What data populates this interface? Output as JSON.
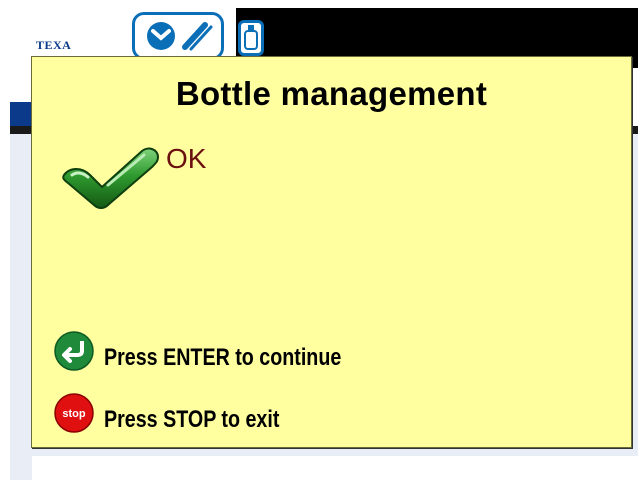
{
  "app": {
    "logo_text": "TEXA"
  },
  "header_icons": [
    {
      "name": "tools-icon"
    },
    {
      "name": "bottle-icon"
    }
  ],
  "dialog": {
    "title": "Bottle management",
    "status_icon": "checkmark-icon",
    "status_text": "OK",
    "hints": [
      {
        "icon": "enter-icon",
        "label": "Press ENTER to continue"
      },
      {
        "icon": "stop-icon",
        "label": "Press STOP to exit",
        "icon_text": "stop"
      }
    ]
  },
  "colors": {
    "dialog_background": "#ffffa0",
    "status_text": "#6b0f0f",
    "check_green": "#2e8b2e",
    "enter_green": "#1f8a3a",
    "stop_red": "#e01010",
    "brand_blue": "#0b3a8a"
  }
}
